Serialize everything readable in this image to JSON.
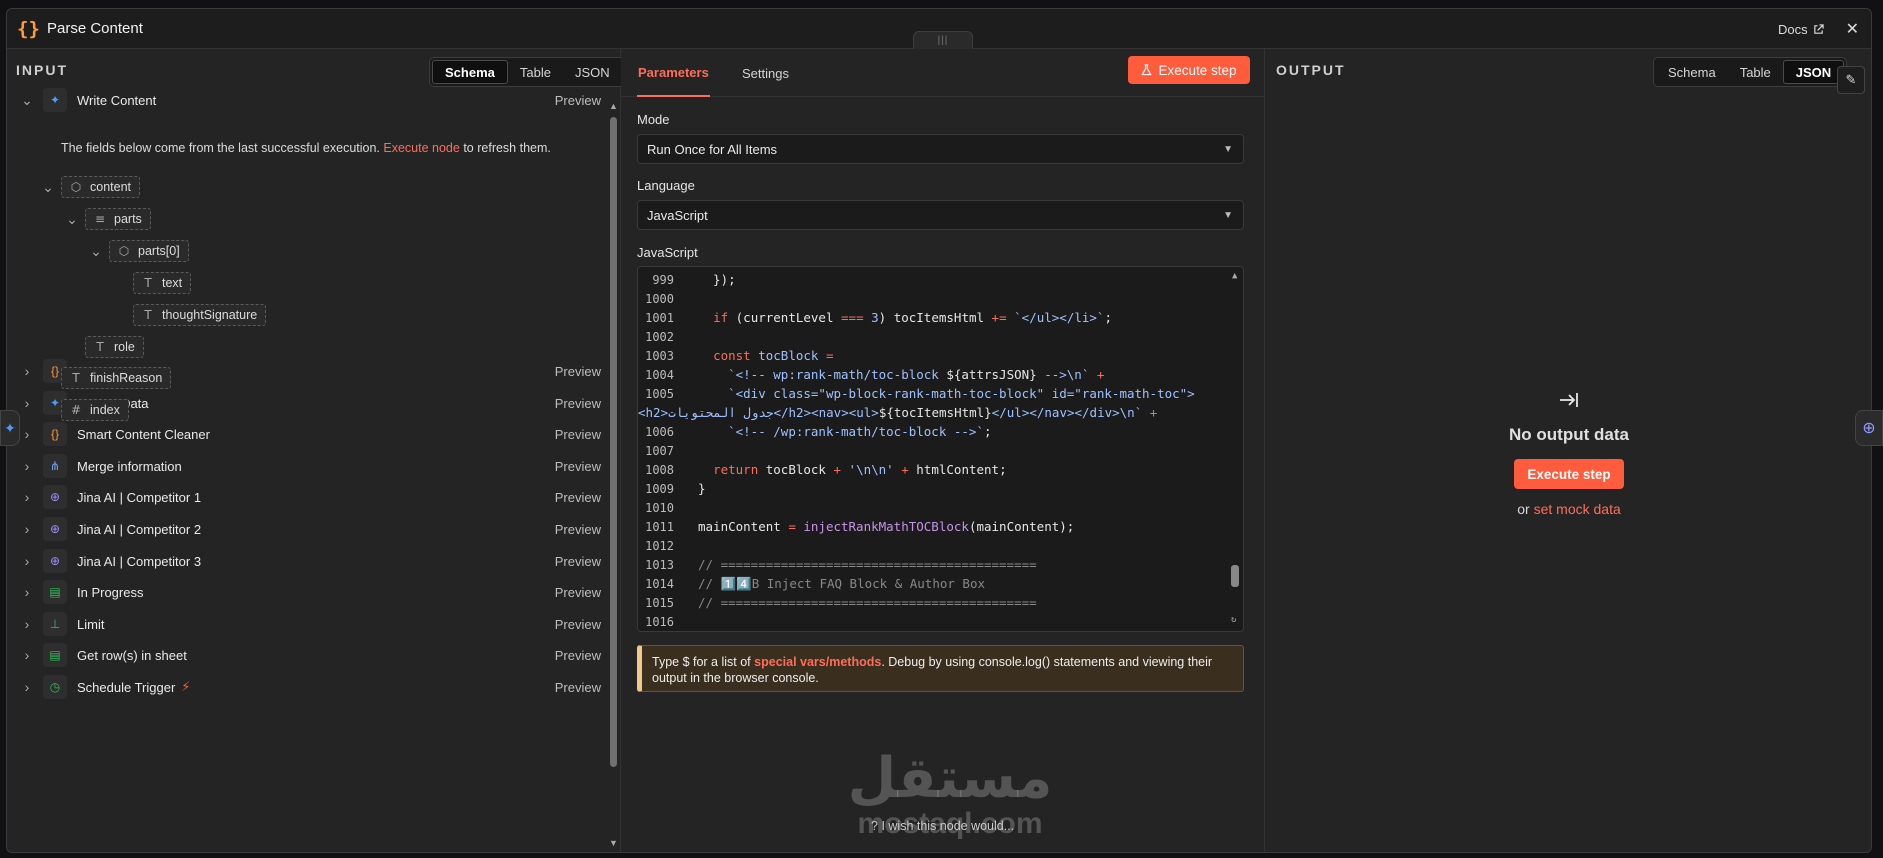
{
  "header": {
    "icon": "{}",
    "title": "Parse Content",
    "docs_label": "Docs",
    "close_label": "✕"
  },
  "input": {
    "title": "INPUT",
    "view_tabs": [
      "Schema",
      "Table",
      "JSON"
    ],
    "active_tab": "Schema",
    "preview_label": "Preview",
    "info_prefix": "The fields below come from the last successful execution.",
    "info_link": "Execute node",
    "info_suffix": "to refresh them.",
    "nodes": [
      {
        "name": "Write Content",
        "icon": "gemini-icon",
        "glyph": "✦",
        "color": "#4a9cff",
        "expanded": true
      },
      {
        "name": "Merge Data",
        "icon": "braces-icon",
        "glyph": "{}",
        "color": "#ff9b3d"
      },
      {
        "name": "Extract Data",
        "icon": "gemini-icon",
        "glyph": "✦",
        "color": "#4a9cff"
      },
      {
        "name": "Smart Content Cleaner",
        "icon": "braces-icon",
        "glyph": "{}",
        "color": "#ff9b3d"
      },
      {
        "name": "Merge information",
        "icon": "merge-icon",
        "glyph": "⋔",
        "color": "#7aa7ff"
      },
      {
        "name": "Jina AI | Competitor 1",
        "icon": "globe-icon",
        "glyph": "⊕",
        "color": "#9d8cff"
      },
      {
        "name": "Jina AI | Competitor 2",
        "icon": "globe-icon",
        "glyph": "⊕",
        "color": "#9d8cff"
      },
      {
        "name": "Jina AI | Competitor 3",
        "icon": "globe-icon",
        "glyph": "⊕",
        "color": "#9d8cff"
      },
      {
        "name": "In Progress",
        "icon": "sheets-icon",
        "glyph": "▤",
        "color": "#2fbf5b"
      },
      {
        "name": "Limit",
        "icon": "limit-icon",
        "glyph": "⊥",
        "color": "#2fbf5b"
      },
      {
        "name": "Get row(s) in sheet",
        "icon": "sheets-icon",
        "glyph": "▤",
        "color": "#2fbf5b"
      },
      {
        "name": "Schedule Trigger",
        "icon": "clock-icon",
        "glyph": "◷",
        "color": "#2fbf5b",
        "trigger": true
      }
    ],
    "schema": [
      {
        "label": "content",
        "type": "object",
        "glyph": "⬡",
        "depth": 0,
        "expandable": true
      },
      {
        "label": "parts",
        "type": "array",
        "glyph": "≡",
        "depth": 1,
        "expandable": true
      },
      {
        "label": "parts[0]",
        "type": "object",
        "glyph": "⬡",
        "depth": 2,
        "expandable": true
      },
      {
        "label": "text",
        "type": "string",
        "glyph": "T",
        "depth": 3
      },
      {
        "label": "thoughtSignature",
        "type": "string",
        "glyph": "T",
        "depth": 3
      },
      {
        "label": "role",
        "type": "string",
        "glyph": "T",
        "depth": 1
      },
      {
        "label": "finishReason",
        "type": "string",
        "glyph": "T",
        "depth": 0
      },
      {
        "label": "index",
        "type": "number",
        "glyph": "#",
        "depth": 0
      }
    ]
  },
  "params": {
    "tabs": [
      "Parameters",
      "Settings"
    ],
    "active_tab": "Parameters",
    "execute_label": "Execute step",
    "mode_label": "Mode",
    "mode_value": "Run Once for All Items",
    "language_label": "Language",
    "language_value": "JavaScript",
    "code_label": "JavaScript",
    "code_lines": [
      {
        "n": "999",
        "html": "  });"
      },
      {
        "n": "1000",
        "html": ""
      },
      {
        "n": "1001",
        "html": "  <span class=\"kw\">if</span> (currentLevel <span class=\"op\">===</span> <span class=\"str\">3</span>) tocItemsHtml <span class=\"op\">+=</span> <span class=\"str\">`&lt;/ul&gt;&lt;/li&gt;`</span>;"
      },
      {
        "n": "1002",
        "html": ""
      },
      {
        "n": "1003",
        "html": "  <span class=\"kw\">const</span> <span class=\"str\">tocBlock</span> <span class=\"op\">=</span>"
      },
      {
        "n": "1004",
        "html": "    <span class=\"str\">`&lt;!-- wp:rank-math/toc-block </span>${attrsJSON}<span class=\"str\"> --&gt;\\n`</span> <span class=\"op\">+</span>"
      },
      {
        "n": "1005",
        "html": "    <span class=\"str\">`&lt;div class=\"wp-block-rank-math-toc-block\" id=\"rank-math-toc\"&gt;</span>"
      },
      {
        "n": "",
        "html": "<span class=\"str\">&lt;h2&gt;جدول المحتويات&lt;/h2&gt;&lt;nav&gt;&lt;ul&gt;</span>${tocItemsHtml}<span class=\"str\">&lt;/ul&gt;&lt;/nav&gt;&lt;/div&gt;\\n`</span> <span class=\"op\">+</span>",
        "wrap": true
      },
      {
        "n": "1006",
        "html": "    <span class=\"str\">`&lt;!-- /wp:rank-math/toc-block --&gt;`</span>;"
      },
      {
        "n": "1007",
        "html": ""
      },
      {
        "n": "1008",
        "html": "  <span class=\"kw\">return</span> tocBlock <span class=\"op\">+</span> <span class=\"str\">'\\n\\n'</span> <span class=\"op\">+</span> htmlContent;"
      },
      {
        "n": "1009",
        "html": "}"
      },
      {
        "n": "1010",
        "html": ""
      },
      {
        "n": "1011",
        "html": "mainContent <span class=\"op\">=</span> <span class=\"fn\">injectRankMathTOCBlock</span>(mainContent);"
      },
      {
        "n": "1012",
        "html": ""
      },
      {
        "n": "1013",
        "html": "<span class=\"cm\">// ==========================================</span>"
      },
      {
        "n": "1014",
        "html": "<span class=\"cm\">// </span><span class=\"str\">1️⃣4️⃣</span><span class=\"cm\">B Inject FAQ Block &amp; Author Box</span>"
      },
      {
        "n": "1015",
        "html": "<span class=\"cm\">// ==========================================</span>"
      },
      {
        "n": "1016",
        "html": ""
      }
    ],
    "tip_prefix": "Type $ for a list of",
    "tip_link": "special vars/methods",
    "tip_suffix": ". Debug by using console.log() statements and viewing their output in the browser console.",
    "wish": "I wish this node would..."
  },
  "output": {
    "title": "OUTPUT",
    "view_tabs": [
      "Schema",
      "Table",
      "JSON"
    ],
    "active_tab": "JSON",
    "empty_title": "No output data",
    "execute_label": "Execute step",
    "or_label": "or",
    "mock_link": "set mock data"
  },
  "watermark": {
    "arabic": "مستقل",
    "latin": "mostaql.com"
  },
  "colors": {
    "accent": "#ff6d5a",
    "execute": "#ff5b3d",
    "panel": "#242424"
  }
}
